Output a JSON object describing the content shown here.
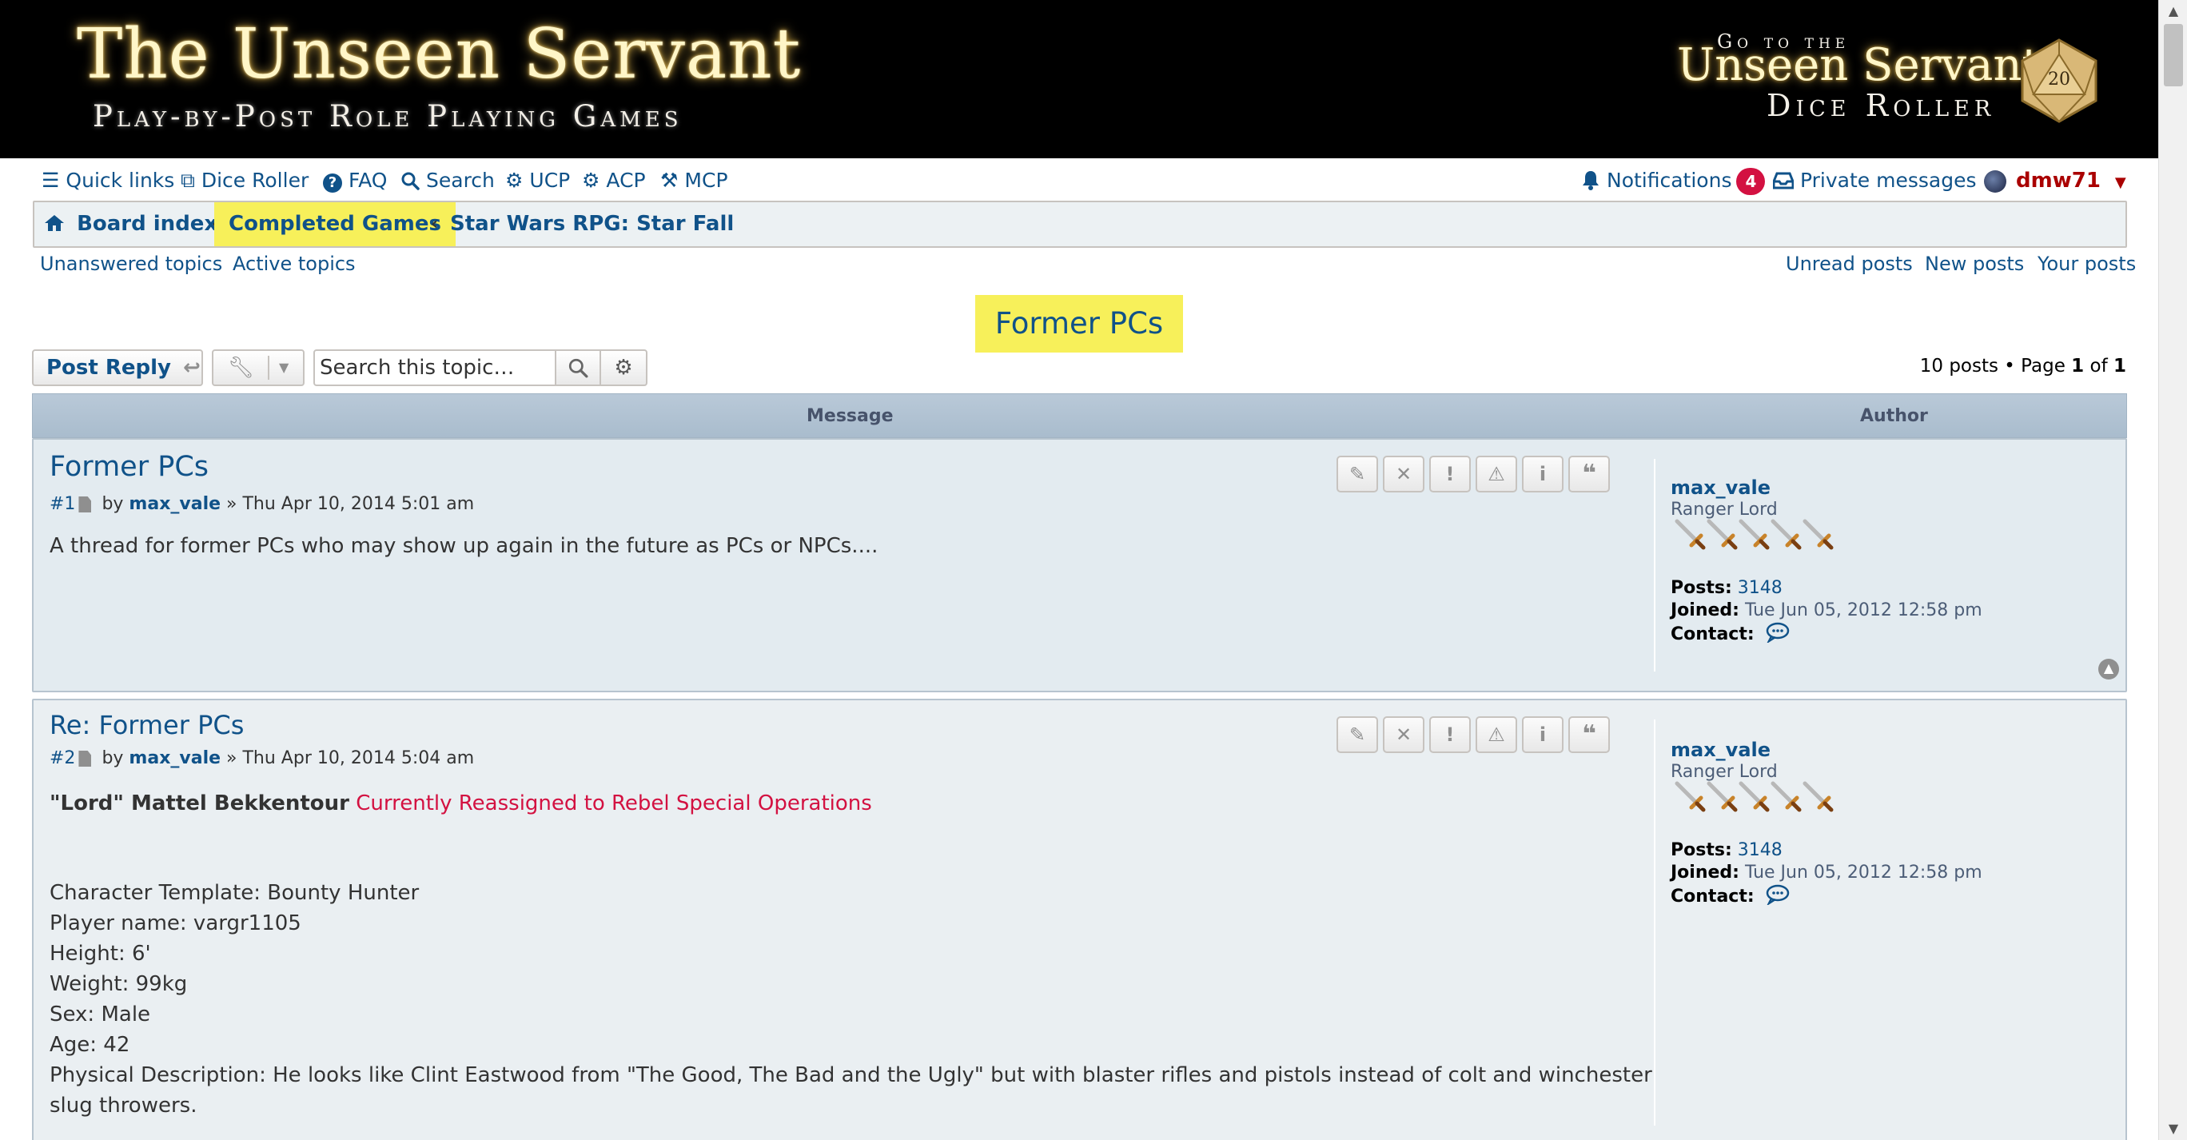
{
  "banner": {
    "logo_title": "The Unseen Servant",
    "logo_subtitle": "Play-by-Post Role Playing Games",
    "dice_go": "Go to the",
    "dice_title": "Unseen Servant",
    "dice_subtitle": "Dice Roller"
  },
  "nav": {
    "quick_links": "Quick links",
    "dice_roller": "Dice Roller",
    "faq": "FAQ",
    "search": "Search",
    "ucp": "UCP",
    "acp": "ACP",
    "mcp": "MCP",
    "notifications": "Notifications",
    "notifications_count": "4",
    "private_messages": "Private messages",
    "username": "dmw71"
  },
  "breadcrumb": {
    "board_index": "Board index",
    "completed_games": "Completed Games",
    "forum": "Star Wars RPG: Star Fall"
  },
  "sublinks": {
    "unanswered": "Unanswered topics",
    "active": "Active topics",
    "unread": "Unread posts",
    "new": "New posts",
    "yours": "Your posts"
  },
  "topic": {
    "title": "Former PCs",
    "post_reply": "Post Reply",
    "search_placeholder": "Search this topic…",
    "posts_count_label": "10 posts • Page",
    "page_current": "1",
    "page_of": "of",
    "page_total": "1"
  },
  "table": {
    "message_header": "Message",
    "author_header": "Author"
  },
  "posts": [
    {
      "title": "Former PCs",
      "number": "#1",
      "by": "by",
      "author": "max_vale",
      "date": "» Thu Apr 10, 2014 5:01 am",
      "body": "A thread for former PCs who may show up again in the future as PCs or NPCs....",
      "profile": {
        "name": "max_vale",
        "rank": "Ranger Lord",
        "posts_label": "Posts:",
        "posts": "3148",
        "joined_label": "Joined:",
        "joined": "Tue Jun 05, 2012 12:58 pm",
        "contact_label": "Contact:"
      }
    },
    {
      "title": "Re: Former PCs",
      "number": "#2",
      "by": "by",
      "author": "max_vale",
      "date": "» Thu Apr 10, 2014 5:04 am",
      "char_name": "\"Lord\" Mattel Bekkentour",
      "char_status": "Currently Reassigned to Rebel Special Operations",
      "lines": [
        "Character Template: Bounty Hunter",
        "Player name: vargr1105",
        "Height: 6'",
        "Weight: 99kg",
        "Sex: Male",
        "Age: 42",
        "Physical Description: He looks like Clint Eastwood from \"The Good, The Bad and the Ugly\" but with blaster rifles and pistols instead of colt and winchester",
        "slug throwers."
      ],
      "profile": {
        "name": "max_vale",
        "rank": "Ranger Lord",
        "posts_label": "Posts:",
        "posts": "3148",
        "joined_label": "Joined:",
        "joined": "Tue Jun 05, 2012 12:58 pm",
        "contact_label": "Contact:"
      }
    }
  ],
  "colors": {
    "link": "#105289",
    "highlight": "#f7f05a",
    "badge": "#d31141",
    "username": "#aa0000",
    "post_bg": "#e1ebf2"
  }
}
